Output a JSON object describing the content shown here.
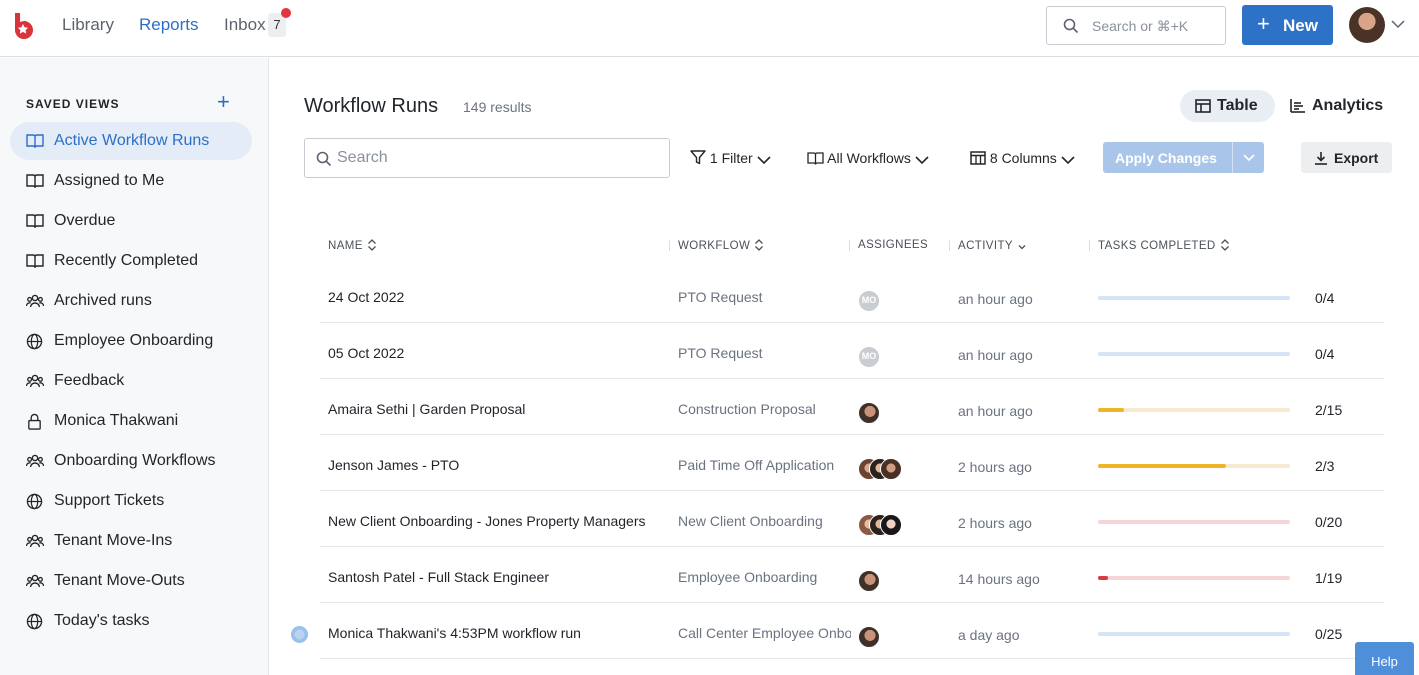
{
  "topnav": {
    "items": [
      {
        "label": "Library"
      },
      {
        "label": "Reports"
      },
      {
        "label": "Inbox"
      }
    ],
    "inbox_count": "7",
    "search_placeholder": "Search or ⌘+K",
    "new_button": "New"
  },
  "sidebar": {
    "title": "SAVED VIEWS",
    "items": [
      {
        "label": "Active Workflow Runs",
        "icon": "book-icon"
      },
      {
        "label": "Assigned to Me",
        "icon": "book-icon"
      },
      {
        "label": "Overdue",
        "icon": "book-icon"
      },
      {
        "label": "Recently Completed",
        "icon": "book-icon"
      },
      {
        "label": "Archived runs",
        "icon": "group-icon"
      },
      {
        "label": "Employee Onboarding",
        "icon": "globe-icon"
      },
      {
        "label": "Feedback",
        "icon": "group-icon"
      },
      {
        "label": "Monica Thakwani",
        "icon": "lock-icon"
      },
      {
        "label": "Onboarding Workflows",
        "icon": "group-icon"
      },
      {
        "label": "Support Tickets",
        "icon": "globe-icon"
      },
      {
        "label": "Tenant Move-Ins",
        "icon": "group-icon"
      },
      {
        "label": "Tenant Move-Outs",
        "icon": "group-icon"
      },
      {
        "label": "Today's tasks",
        "icon": "globe-icon"
      }
    ]
  },
  "main": {
    "title": "Workflow Runs",
    "results": "149 results",
    "view_table": "Table",
    "view_analytics": "Analytics",
    "search_placeholder": "Search",
    "filter": "1 Filter",
    "workflows": "All Workflows",
    "columns": "8 Columns",
    "apply": "Apply Changes",
    "export": "Export"
  },
  "table": {
    "headers": {
      "name": "NAME",
      "workflow": "WORKFLOW",
      "assignees": "ASSIGNEES",
      "activity": "ACTIVITY",
      "tasks": "TASKS COMPLETED"
    },
    "rows": [
      {
        "name": "24 Oct 2022",
        "workflow": "PTO Request",
        "activity": "an hour ago",
        "tasks": "0/4",
        "progress": 0,
        "track_color": "#d6e5f6",
        "fill_color": "#4f8ed8",
        "assignees": [
          {
            "initials": "MO"
          }
        ]
      },
      {
        "name": "05 Oct 2022",
        "workflow": "PTO Request",
        "activity": "an hour ago",
        "tasks": "0/4",
        "progress": 0,
        "track_color": "#d6e5f6",
        "fill_color": "#4f8ed8",
        "assignees": [
          {
            "initials": "MO"
          }
        ]
      },
      {
        "name": "Amaira Sethi | Garden Proposal",
        "workflow": "Construction Proposal",
        "activity": "an hour ago",
        "tasks": "2/15",
        "progress": 0.133,
        "track_color": "#f7ead0",
        "fill_color": "#f0b429",
        "assignees": [
          {
            "photo": "man"
          }
        ]
      },
      {
        "name": "Jenson James - PTO",
        "workflow": "Paid Time Off Application",
        "activity": "2 hours ago",
        "tasks": "2/3",
        "progress": 0.667,
        "track_color": "#f7ead0",
        "fill_color": "#f0b429",
        "assignees": [
          {
            "photo": "woman1"
          },
          {
            "photo": "woman2"
          },
          {
            "photo": "woman3"
          }
        ]
      },
      {
        "name": "New Client Onboarding - Jones Property Managers",
        "workflow": "New Client Onboarding",
        "activity": "2 hours ago",
        "tasks": "0/20",
        "progress": 0,
        "track_color": "#f5d5d7",
        "fill_color": "#d93b45",
        "assignees": [
          {
            "photo": "woman4"
          },
          {
            "photo": "woman2"
          },
          {
            "photo": "woman5"
          }
        ]
      },
      {
        "name": "Santosh Patel - Full Stack Engineer",
        "workflow": "Employee Onboarding",
        "activity": "14 hours ago",
        "tasks": "1/19",
        "progress": 0.053,
        "track_color": "#f5d5d7",
        "fill_color": "#d93b45",
        "assignees": [
          {
            "photo": "man"
          }
        ]
      },
      {
        "name": "Monica Thakwani's 4:53PM workflow run",
        "workflow": "Call Center Employee Onboarding",
        "activity": "a day ago",
        "tasks": "0/25",
        "progress": 0,
        "track_color": "#d6e5f6",
        "fill_color": "#4f8ed8",
        "assignees": [
          {
            "photo": "man"
          }
        ]
      }
    ]
  },
  "help": "Help",
  "colors": {
    "accent": "#2e72c8",
    "badge_dot": "#e4343f"
  }
}
